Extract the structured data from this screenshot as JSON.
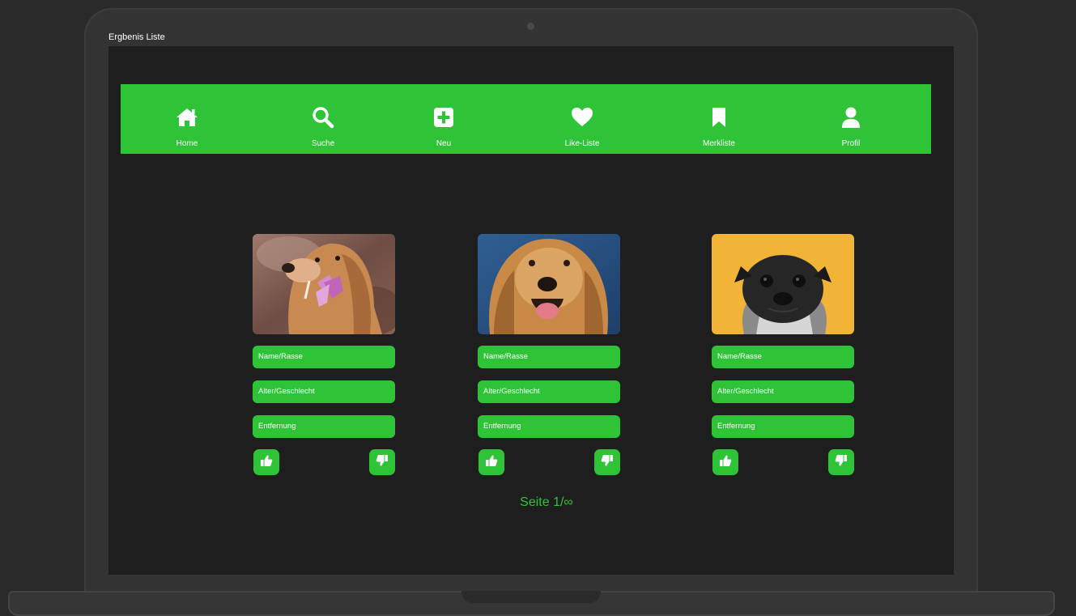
{
  "frame": {
    "label": "Ergbenis Liste"
  },
  "nav": {
    "items": [
      {
        "label": "Home",
        "icon": "home-icon"
      },
      {
        "label": "Suche",
        "icon": "search-icon"
      },
      {
        "label": "Neu",
        "icon": "plus-square-icon"
      },
      {
        "label": "Like-Liste",
        "icon": "heart-icon"
      },
      {
        "label": "Merkliste",
        "icon": "bookmark-icon"
      },
      {
        "label": "Profil",
        "icon": "user-icon"
      }
    ]
  },
  "cards": [
    {
      "photo": "golden-retriever-with-flower",
      "name_label": "Name/Rasse",
      "age_label": "Alter/Geschlecht",
      "distance_label": "Entfernung",
      "like_icon": "thumbs-up-icon",
      "dislike_icon": "thumbs-down-icon"
    },
    {
      "photo": "golden-retriever-smiling",
      "name_label": "Name/Rasse",
      "age_label": "Alter/Geschlecht",
      "distance_label": "Entfernung",
      "like_icon": "thumbs-up-icon",
      "dislike_icon": "thumbs-down-icon"
    },
    {
      "photo": "black-pug-yellow-background",
      "name_label": "Name/Rasse",
      "age_label": "Alter/Geschlecht",
      "distance_label": "Entfernung",
      "like_icon": "thumbs-up-icon",
      "dislike_icon": "thumbs-down-icon"
    }
  ],
  "pagination": {
    "text": "Seite 1/∞"
  },
  "colors": {
    "accent": "#2fc438",
    "screen_bg": "#1e1e1e",
    "frame": "#333333",
    "text_on_accent": "#ffffff"
  }
}
